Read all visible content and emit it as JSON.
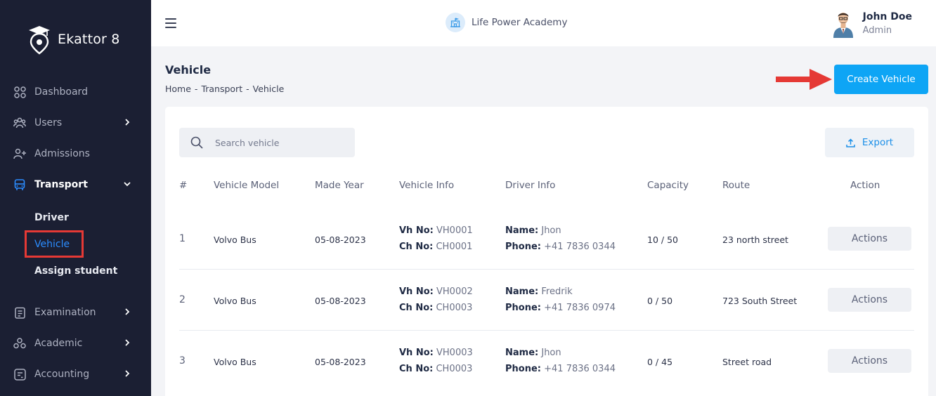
{
  "brand": {
    "name": "Ekattor 8"
  },
  "sidebar": {
    "items": [
      {
        "label": "Dashboard",
        "icon": "dashboard-icon",
        "has_children": false
      },
      {
        "label": "Users",
        "icon": "users-icon",
        "has_children": true
      },
      {
        "label": "Admissions",
        "icon": "admissions-icon",
        "has_children": false
      },
      {
        "label": "Transport",
        "icon": "bus-icon",
        "has_children": true,
        "expanded": true
      },
      {
        "label": "Examination",
        "icon": "exam-icon",
        "has_children": true
      },
      {
        "label": "Academic",
        "icon": "academic-icon",
        "has_children": true
      },
      {
        "label": "Accounting",
        "icon": "accounting-icon",
        "has_children": true
      }
    ],
    "transport_sub": [
      {
        "label": "Driver"
      },
      {
        "label": "Vehicle",
        "current": true
      },
      {
        "label": "Assign student"
      }
    ]
  },
  "topbar": {
    "school_name": "Life Power Academy",
    "user_name": "John Doe",
    "user_role": "Admin"
  },
  "page": {
    "title": "Vehicle",
    "breadcrumb": [
      "Home",
      "-",
      "Transport",
      "-",
      "Vehicle"
    ],
    "create_button": "Create Vehicle"
  },
  "toolbar": {
    "search_placeholder": "Search vehicle",
    "export_label": "Export"
  },
  "table": {
    "headers": [
      "#",
      "Vehicle Model",
      "Made Year",
      "Vehicle Info",
      "Driver Info",
      "Capacity",
      "Route",
      "Action"
    ],
    "vh_label": "Vh No:",
    "ch_label": "Ch No:",
    "name_label": "Name:",
    "phone_label": "Phone:",
    "rows": [
      {
        "num": "1",
        "model": "Volvo Bus",
        "year": "05-08-2023",
        "vh": "VH0001",
        "ch": "CH0001",
        "driver": "Jhon",
        "phone": "+41 7836 0344",
        "capacity": "10 / 50",
        "route": "23 north street",
        "action": "Actions"
      },
      {
        "num": "2",
        "model": "Volvo Bus",
        "year": "05-08-2023",
        "vh": "VH0002",
        "ch": "CH0003",
        "driver": "Fredrik",
        "phone": "+41 7836 0974",
        "capacity": "0 / 50",
        "route": "723 South Street",
        "action": "Actions"
      },
      {
        "num": "3",
        "model": "Volvo Bus",
        "year": "05-08-2023",
        "vh": "VH0003",
        "ch": "CH0003",
        "driver": "Jhon",
        "phone": "+41 7836 0344",
        "capacity": "0 / 45",
        "route": "Street road",
        "action": "Actions"
      }
    ]
  },
  "colors": {
    "sidebar_bg": "#1b1f33",
    "accent": "#0ea5f5",
    "highlight": "#e53935"
  }
}
